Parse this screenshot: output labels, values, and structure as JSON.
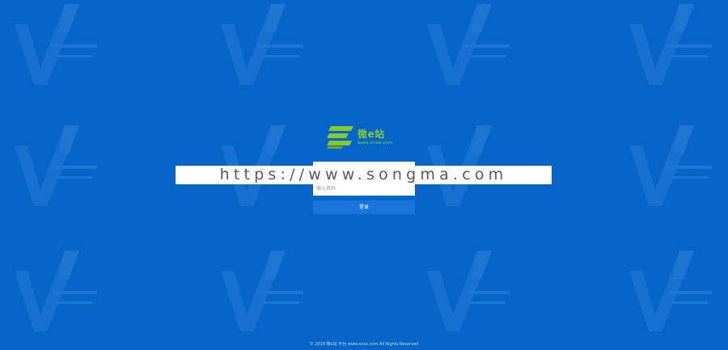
{
  "background_color": "#0665c9",
  "accent_color": "#86c832",
  "button_color": "#1775dc",
  "watermark": {
    "icon": "v-logo-icon"
  },
  "logo": {
    "icon": "stacked-e-logo-icon",
    "name": "微e站",
    "url": "www.vinee.com"
  },
  "url_banner": "https://www.songma.com",
  "login": {
    "password_placeholder": "输入密码",
    "submit_label": "登录"
  },
  "footer": "© 2019 微e站 平台 www.xxxx.com All Rights Reserved"
}
